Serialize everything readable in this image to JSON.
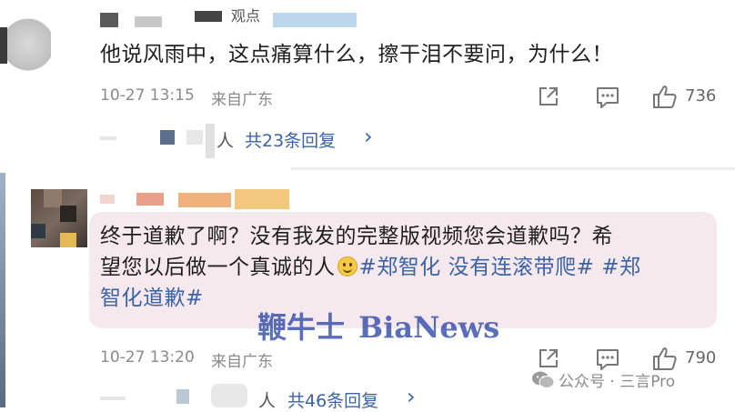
{
  "comment1": {
    "username_partial": "观点",
    "text": "他说风雨中，这点痛算什么，擦干泪不要问，为什么！",
    "time": "10-27 13:15",
    "location": "来自广东",
    "like_count": "736",
    "reply_suffix": "人",
    "reply_count_text": "共23条回复",
    "reply_chevron": "›"
  },
  "comment2": {
    "text_line1": "终于道歉了啊？没有我发的完整版视频您会道歉吗？希",
    "text_line2_prefix": "望您以后做一个真诚的人",
    "hashtag1": "#郑智化",
    "hashtag2": "没有连滚带爬#",
    "hashtag3_a": "#郑",
    "hashtag3_b": "智化道歉#",
    "time": "10-27 13:20",
    "location": "来自广东",
    "like_count": "790",
    "reply_suffix": "人",
    "reply_count_text": "共46条回复",
    "reply_chevron": "›"
  },
  "watermark": {
    "chinese": "鞭牛士",
    "latin": "BiaNews"
  },
  "wechat_badge": {
    "text": "公众号 · 三言Pro"
  },
  "icons": {
    "share": "share-icon",
    "comment": "comment-icon",
    "like": "thumbs-up-icon",
    "wechat": "wechat-icon"
  },
  "colors": {
    "link_blue": "#3b63a8",
    "highlight_bg": "#f6e9ee",
    "meta_gray": "#8a8a8a"
  }
}
